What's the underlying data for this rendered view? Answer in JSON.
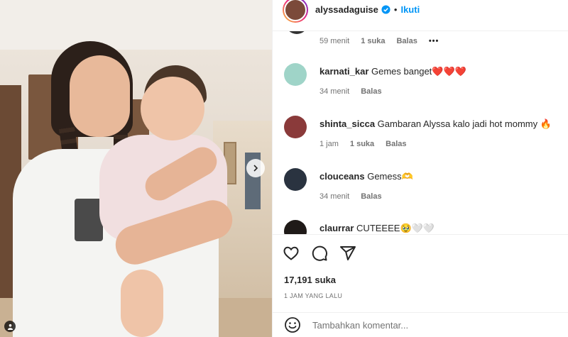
{
  "post": {
    "username": "alyssadaguise",
    "follow_label": "Ikuti",
    "separator": "•"
  },
  "previous_comment": {
    "time": "59 menit",
    "likes": "1 suka",
    "reply": "Balas",
    "more": "•••"
  },
  "comments": [
    {
      "user": "karnati_kar",
      "text": "Gemes banget❤️❤️❤️",
      "time": "34 menit",
      "likes": "",
      "reply": "Balas",
      "avatar_color": "#9fd4c8"
    },
    {
      "user": "shinta_sicca",
      "text": "Gambaran Alyssa kalo jadi hot mommy 🔥",
      "time": "1 jam",
      "likes": "1 suka",
      "reply": "Balas",
      "avatar_color": "#8a3a3a"
    },
    {
      "user": "clouceans",
      "text": "Gemess🫶",
      "time": "34 menit",
      "likes": "",
      "reply": "Balas",
      "avatar_color": "#2a3340"
    },
    {
      "user": "claurrar",
      "text": "CUTEEEE🥹🤍🤍",
      "time": "",
      "likes": "",
      "reply": "",
      "avatar_color": "#1f1a18"
    }
  ],
  "stats": {
    "likes": "17,191 suka",
    "time_ago": "1 JAM YANG LALU"
  },
  "composer": {
    "placeholder": "Tambahkan komentar..."
  },
  "icons": {
    "like": "heart-icon",
    "comment": "comment-icon",
    "share": "share-icon",
    "emoji": "emoji-icon",
    "verified": "verified-badge-icon",
    "next": "chevron-right-icon",
    "tag": "user-tag-icon"
  },
  "colors": {
    "accent": "#0095f6",
    "text": "#262626",
    "muted": "#737373",
    "divider": "#efefef"
  }
}
